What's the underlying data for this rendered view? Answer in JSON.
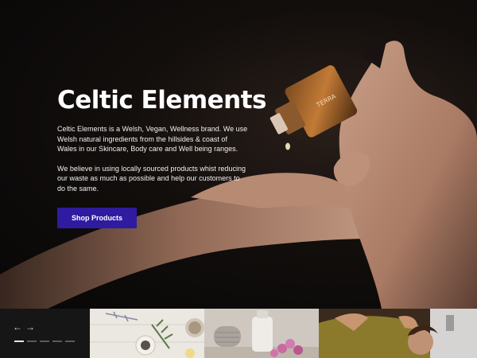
{
  "hero": {
    "title": "Celtic Elements",
    "paragraph1": "Celtic Elements is a Welsh, Vegan, Wellness brand. We use Welsh natural ingredients from the hillsides & coast of Wales in our Skincare, Body care and Well being ranges.",
    "paragraph2": "We believe in using locally sourced products whist reducing our waste as much as possible and help our customers to do the same.",
    "cta_label": "Shop Products",
    "bottle_label": "TERRA"
  },
  "slider": {
    "prev_icon": "←",
    "next_icon": "→",
    "dots": [
      {
        "active": true
      },
      {
        "active": false
      },
      {
        "active": false
      },
      {
        "active": false
      },
      {
        "active": false
      }
    ]
  },
  "colors": {
    "accent": "#2f1ba0",
    "background": "#0b0b0b"
  }
}
